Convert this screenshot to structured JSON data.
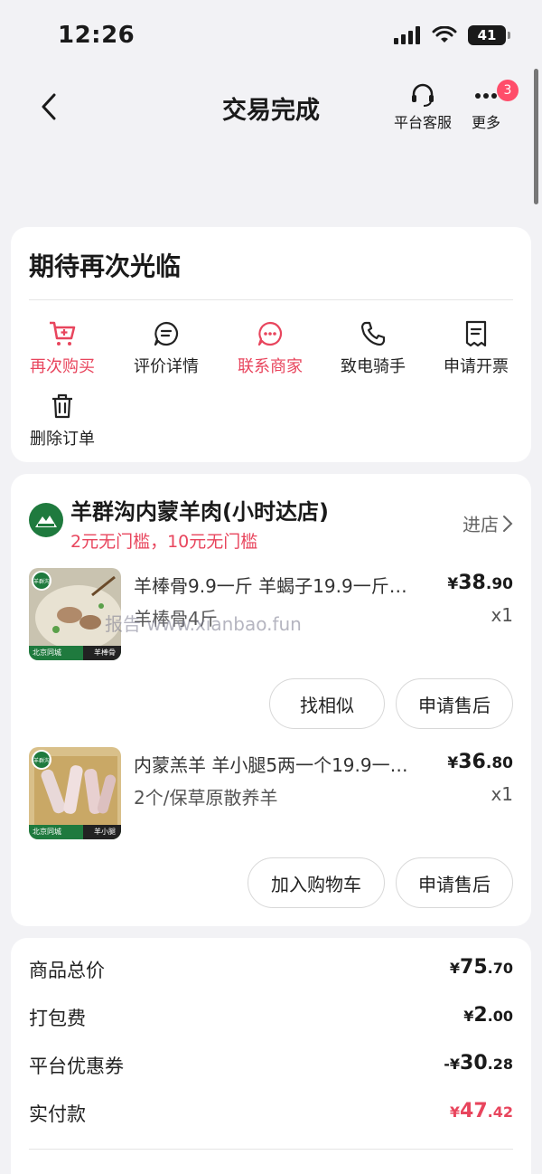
{
  "status_bar": {
    "time": "12:26",
    "battery": "41"
  },
  "nav": {
    "title": "交易完成",
    "service_label": "平台客服",
    "more_label": "更多",
    "more_badge": "3"
  },
  "summary": {
    "title": "期待再次光临",
    "actions": [
      {
        "label": "再次购买",
        "icon": "cart-plus-icon",
        "color": "#e8455d"
      },
      {
        "label": "评价详情",
        "icon": "comment-icon",
        "color": "#222222"
      },
      {
        "label": "联系商家",
        "icon": "chat-dots-icon",
        "color": "#e8455d"
      },
      {
        "label": "致电骑手",
        "icon": "phone-icon",
        "color": "#222222"
      },
      {
        "label": "申请开票",
        "icon": "receipt-icon",
        "color": "#222222"
      },
      {
        "label": "删除订单",
        "icon": "trash-icon",
        "color": "#222222"
      }
    ]
  },
  "shop": {
    "name": "羊群沟内蒙羊肉(小时达店)",
    "promo": "2元无门槛，10元无门槛",
    "enter_label": "进店",
    "logo_text": "羊群沟"
  },
  "products": [
    {
      "name": "羊棒骨9.9一斤 羊蝎子19.9一斤…",
      "spec": "羊棒骨4斤",
      "price_symbol": "¥",
      "price_int": "38",
      "price_dec": ".90",
      "qty": "x1",
      "img_tag_left": "北京同城",
      "img_tag_right": "羊棒骨",
      "img_logo": "羊群沟",
      "buttons": [
        "找相似",
        "申请售后"
      ]
    },
    {
      "name": "内蒙羔羊 羊小腿5两一个19.9一…",
      "spec": "2个/保草原散养羊",
      "price_symbol": "¥",
      "price_int": "36",
      "price_dec": ".80",
      "qty": "x1",
      "img_tag_left": "北京同城",
      "img_tag_right": "羊小腿",
      "img_logo": "羊群沟",
      "buttons": [
        "加入购物车",
        "申请售后"
      ]
    }
  ],
  "watermark": "报告 www.xianbao.fun",
  "totals": [
    {
      "label": "商品总价",
      "prefix": "",
      "symbol": "¥",
      "int": "75",
      "dec": ".70"
    },
    {
      "label": "打包费",
      "prefix": "",
      "symbol": "¥",
      "int": "2",
      "dec": ".00"
    },
    {
      "label": "平台优惠券",
      "prefix": "-",
      "symbol": "¥",
      "int": "30",
      "dec": ".28"
    },
    {
      "label": "实付款",
      "prefix": "",
      "symbol": "¥",
      "int": "47",
      "dec": ".42"
    }
  ],
  "colors": {
    "accent": "#e8455d",
    "background": "#f2f2f5",
    "shop_green": "#1f7a3e"
  }
}
